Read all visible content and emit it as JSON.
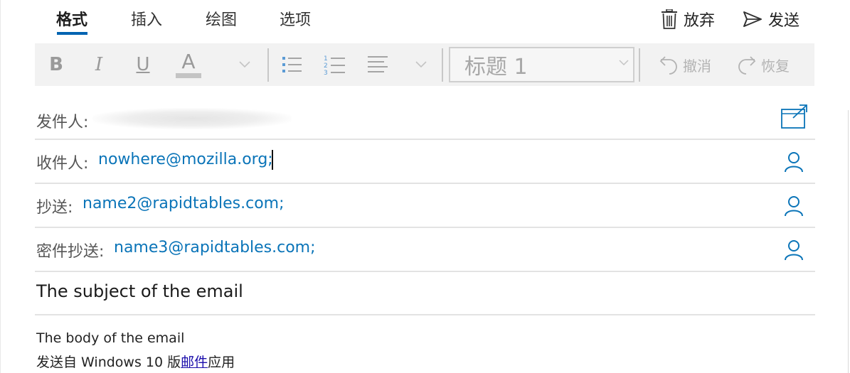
{
  "tabs": [
    {
      "label": "格式",
      "active": true
    },
    {
      "label": "插入",
      "active": false
    },
    {
      "label": "绘图",
      "active": false
    },
    {
      "label": "选项",
      "active": false
    }
  ],
  "actions": {
    "discard_label": "放弃",
    "send_label": "发送"
  },
  "toolbar": {
    "bold": "B",
    "italic": "I",
    "underline": "U",
    "font_color": "A",
    "style_value": "标题 1",
    "undo_label": "撤消",
    "redo_label": "恢复"
  },
  "from": {
    "label": "发件人:"
  },
  "to": {
    "label": "收件人:",
    "value": "nowhere@mozilla.org;"
  },
  "cc": {
    "label": "抄送:",
    "value": "name2@rapidtables.com;"
  },
  "bcc": {
    "label": "密件抄送:",
    "value": "name3@rapidtables.com;"
  },
  "subject": "The subject of the email",
  "body": {
    "line1": "The body of the email",
    "signature_prefix": "发送自 Windows 10 版",
    "signature_link": "邮件",
    "signature_suffix": "应用"
  },
  "colors": {
    "accent": "#0063b1",
    "link": "#0a74b8",
    "toolbar_bg": "#f2f2f2"
  },
  "icons": [
    "trash-icon",
    "send-icon",
    "bullet-list-icon",
    "numbered-list-icon",
    "align-icon",
    "undo-icon",
    "redo-icon",
    "popout-icon",
    "person-icon"
  ]
}
